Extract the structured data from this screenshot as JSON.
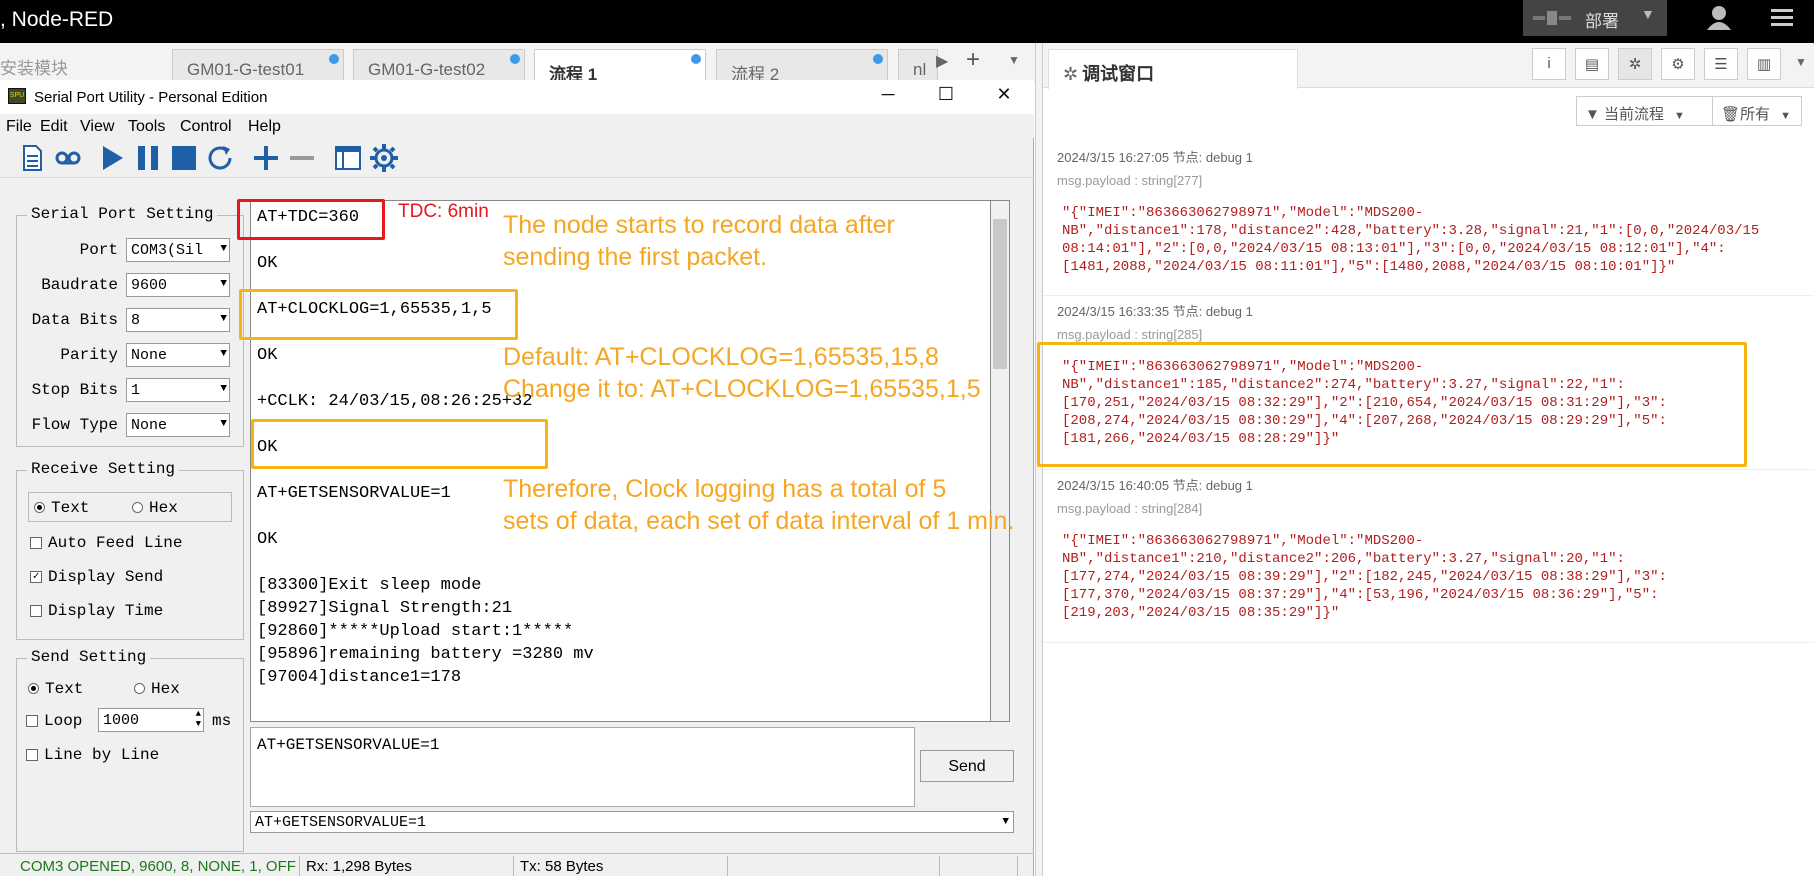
{
  "app": {
    "title": ", Node-RED"
  },
  "header": {
    "deploy_label": "部署",
    "deploy_caret": "▼"
  },
  "tabs": {
    "install_label": "安装模块",
    "items": [
      {
        "label": "GM01-G-test01"
      },
      {
        "label": "GM01-G-test02"
      },
      {
        "label": "流程 1"
      },
      {
        "label": "流程 2"
      },
      {
        "label": "nl"
      }
    ],
    "scroll_right": "▶",
    "add": "+",
    "menu": "▼"
  },
  "serial_window": {
    "title": "Serial Port Utility - Personal Edition",
    "min": "─",
    "max": "☐",
    "close": "✕",
    "menus": [
      "File",
      "Edit",
      "View",
      "Tools",
      "Control",
      "Help"
    ],
    "port_setting": {
      "title": "Serial Port Setting",
      "rows": [
        {
          "label": "Port",
          "value": "COM3(Sil"
        },
        {
          "label": "Baudrate",
          "value": "9600"
        },
        {
          "label": "Data Bits",
          "value": "8"
        },
        {
          "label": "Parity",
          "value": "None"
        },
        {
          "label": "Stop Bits",
          "value": "1"
        },
        {
          "label": "Flow Type",
          "value": "None"
        }
      ]
    },
    "receive_setting": {
      "title": "Receive Setting",
      "text": "Text",
      "hex": "Hex",
      "auto_feed": "Auto Feed Line",
      "display_send": "Display Send",
      "display_time": "Display Time",
      "check_mark": "✓"
    },
    "send_setting": {
      "title": "Send Setting",
      "text": "Text",
      "hex": "Hex",
      "loop": "Loop",
      "loop_value": "1000",
      "ms": "ms",
      "line_by_line": "Line by Line"
    },
    "terminal_lines": [
      "AT+TDC=360",
      "OK",
      "AT+CLOCKLOG=1,65535,1,5",
      "OK",
      "+CCLK: 24/03/15,08:26:25+32",
      "OK",
      "AT+GETSENSORVALUE=1",
      "OK",
      "[83300]Exit sleep mode",
      "[89927]Signal Strength:21",
      "[92860]*****Upload start:1*****",
      "[95896]remaining battery =3280 mv",
      "[97004]distance1=178"
    ],
    "send_text": "AT+GETSENSORVALUE=1",
    "send_button": "Send",
    "cmd_value": "AT+GETSENSORVALUE=1",
    "status": {
      "port": "COM3 OPENED, 9600, 8, NONE, 1, OFF",
      "rx": "Rx: 1,298 Bytes",
      "tx": "Tx: 58 Bytes"
    }
  },
  "annotations": {
    "tdc": "TDC: 6min",
    "note1": [
      "The node starts to record data after",
      "sending the first packet."
    ],
    "note2": [
      "Default: AT+CLOCKLOG=1,65535,15,8",
      "Change it to: AT+CLOCKLOG=1,65535,1,5"
    ],
    "note3": [
      "Therefore, Clock logging has a total of 5",
      "sets of data, each set of data interval of 1 min."
    ],
    "colors": {
      "red": "#e5181d",
      "orange": "#f5b50e",
      "text_orange": "#f5a623"
    }
  },
  "debug": {
    "tab_label": "调试窗口",
    "tab_icon": "bug-icon",
    "filter_flow": "当前流程",
    "filter_all": "所有",
    "messages": [
      {
        "meta": "2024/3/15 16:27:05   节点: debug 1",
        "type": "msg.payload : string[277]",
        "payload": "\"{\"IMEI\":\"863663062798971\",\"Model\":\"MDS200-\nNB\",\"distance1\":178,\"distance2\":428,\"battery\":3.28,\"signal\":21,\"1\":[0,0,\"2024/03/15\n08:14:01\"],\"2\":[0,0,\"2024/03/15 08:13:01\"],\"3\":[0,0,\"2024/03/15 08:12:01\"],\"4\":\n[1481,2088,\"2024/03/15 08:11:01\"],\"5\":[1480,2088,\"2024/03/15 08:10:01\"]}\""
      },
      {
        "meta": "2024/3/15 16:33:35   节点: debug 1",
        "type": "msg.payload : string[285]",
        "payload": "\"{\"IMEI\":\"863663062798971\",\"Model\":\"MDS200-\nNB\",\"distance1\":185,\"distance2\":274,\"battery\":3.27,\"signal\":22,\"1\":\n[170,251,\"2024/03/15 08:32:29\"],\"2\":[210,654,\"2024/03/15 08:31:29\"],\"3\":\n[208,274,\"2024/03/15 08:30:29\"],\"4\":[207,268,\"2024/03/15 08:29:29\"],\"5\":\n[181,266,\"2024/03/15 08:28:29\"]}\""
      },
      {
        "meta": "2024/3/15 16:40:05   节点: debug 1",
        "type": "msg.payload : string[284]",
        "payload": "\"{\"IMEI\":\"863663062798971\",\"Model\":\"MDS200-\nNB\",\"distance1\":210,\"distance2\":206,\"battery\":3.27,\"signal\":20,\"1\":\n[177,274,\"2024/03/15 08:39:29\"],\"2\":[182,245,\"2024/03/15 08:38:29\"],\"3\":\n[177,370,\"2024/03/15 08:37:29\"],\"4\":[53,196,\"2024/03/15 08:36:29\"],\"5\":\n[219,203,\"2024/03/15 08:35:29\"]}\""
      }
    ]
  }
}
